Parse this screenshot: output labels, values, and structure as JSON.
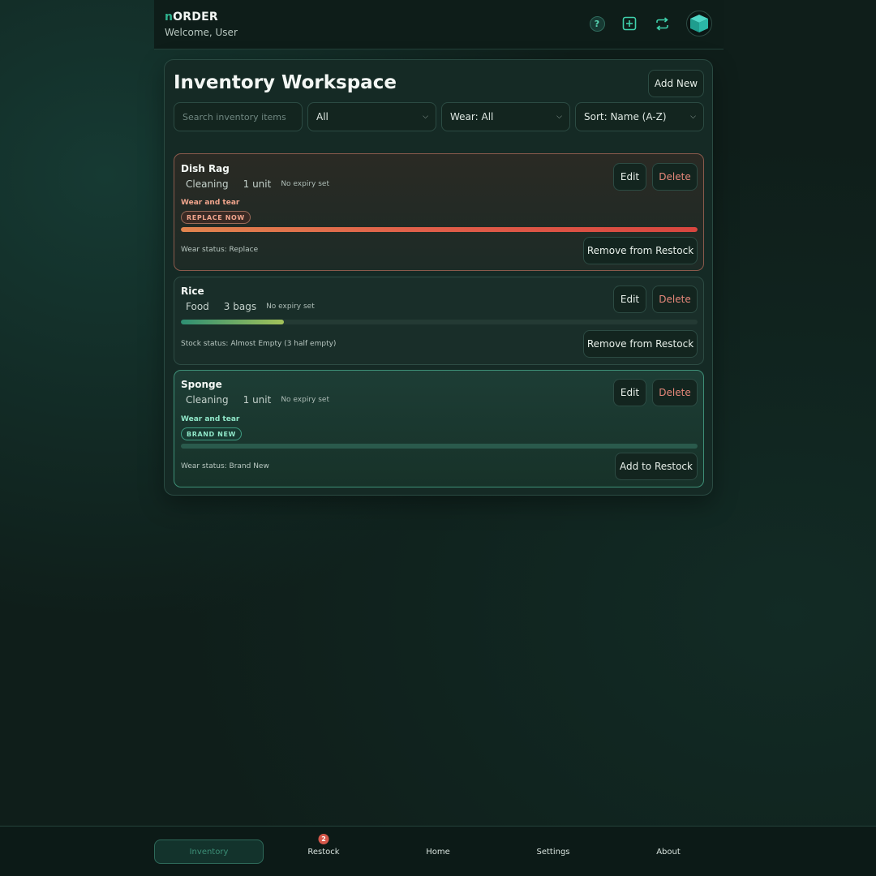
{
  "header": {
    "brand_accent": "n",
    "brand_rest": "ORDER",
    "welcome": "Welcome, User",
    "help_label": "?",
    "icons": [
      "help-icon",
      "add-square-icon",
      "repeat-icon",
      "cube-icon"
    ]
  },
  "workspace": {
    "title": "Inventory Workspace",
    "add_new_label": "Add New",
    "search_placeholder": "Search inventory items",
    "category_filter": "All",
    "wear_filter": "Wear: All",
    "sort": "Sort: Name (A-Z)"
  },
  "items": [
    {
      "name": "Dish Rag",
      "category": "Cleaning",
      "quantity": "1 unit",
      "expiry": "No expiry set",
      "wear_label": "Wear and tear",
      "badge": "REPLACE NOW",
      "wear_level": 1.0,
      "status": "Wear status: Replace",
      "edit_label": "Edit",
      "delete_label": "Delete",
      "action_label": "Remove from Restock"
    },
    {
      "name": "Rice",
      "category": "Food",
      "quantity": "3 bags",
      "expiry": "No expiry set",
      "stock_level": 0.2,
      "status": "Stock status: Almost Empty (3 half empty)",
      "edit_label": "Edit",
      "delete_label": "Delete",
      "action_label": "Remove from Restock"
    },
    {
      "name": "Sponge",
      "category": "Cleaning",
      "quantity": "1 unit",
      "expiry": "No expiry set",
      "wear_label": "Wear and tear",
      "badge": "BRAND NEW",
      "wear_level": 0.0,
      "status": "Wear status: Brand New",
      "edit_label": "Edit",
      "delete_label": "Delete",
      "action_label": "Add to Restock"
    }
  ],
  "nav": {
    "inventory": "Inventory",
    "restock": "Restock",
    "restock_count": "2",
    "home": "Home",
    "settings": "Settings",
    "about": "About"
  },
  "colors": {
    "accent": "#2fb38f",
    "danger": "#e7887a",
    "replace_bar": "#e0604a",
    "badge_notification": "#d4574a"
  }
}
